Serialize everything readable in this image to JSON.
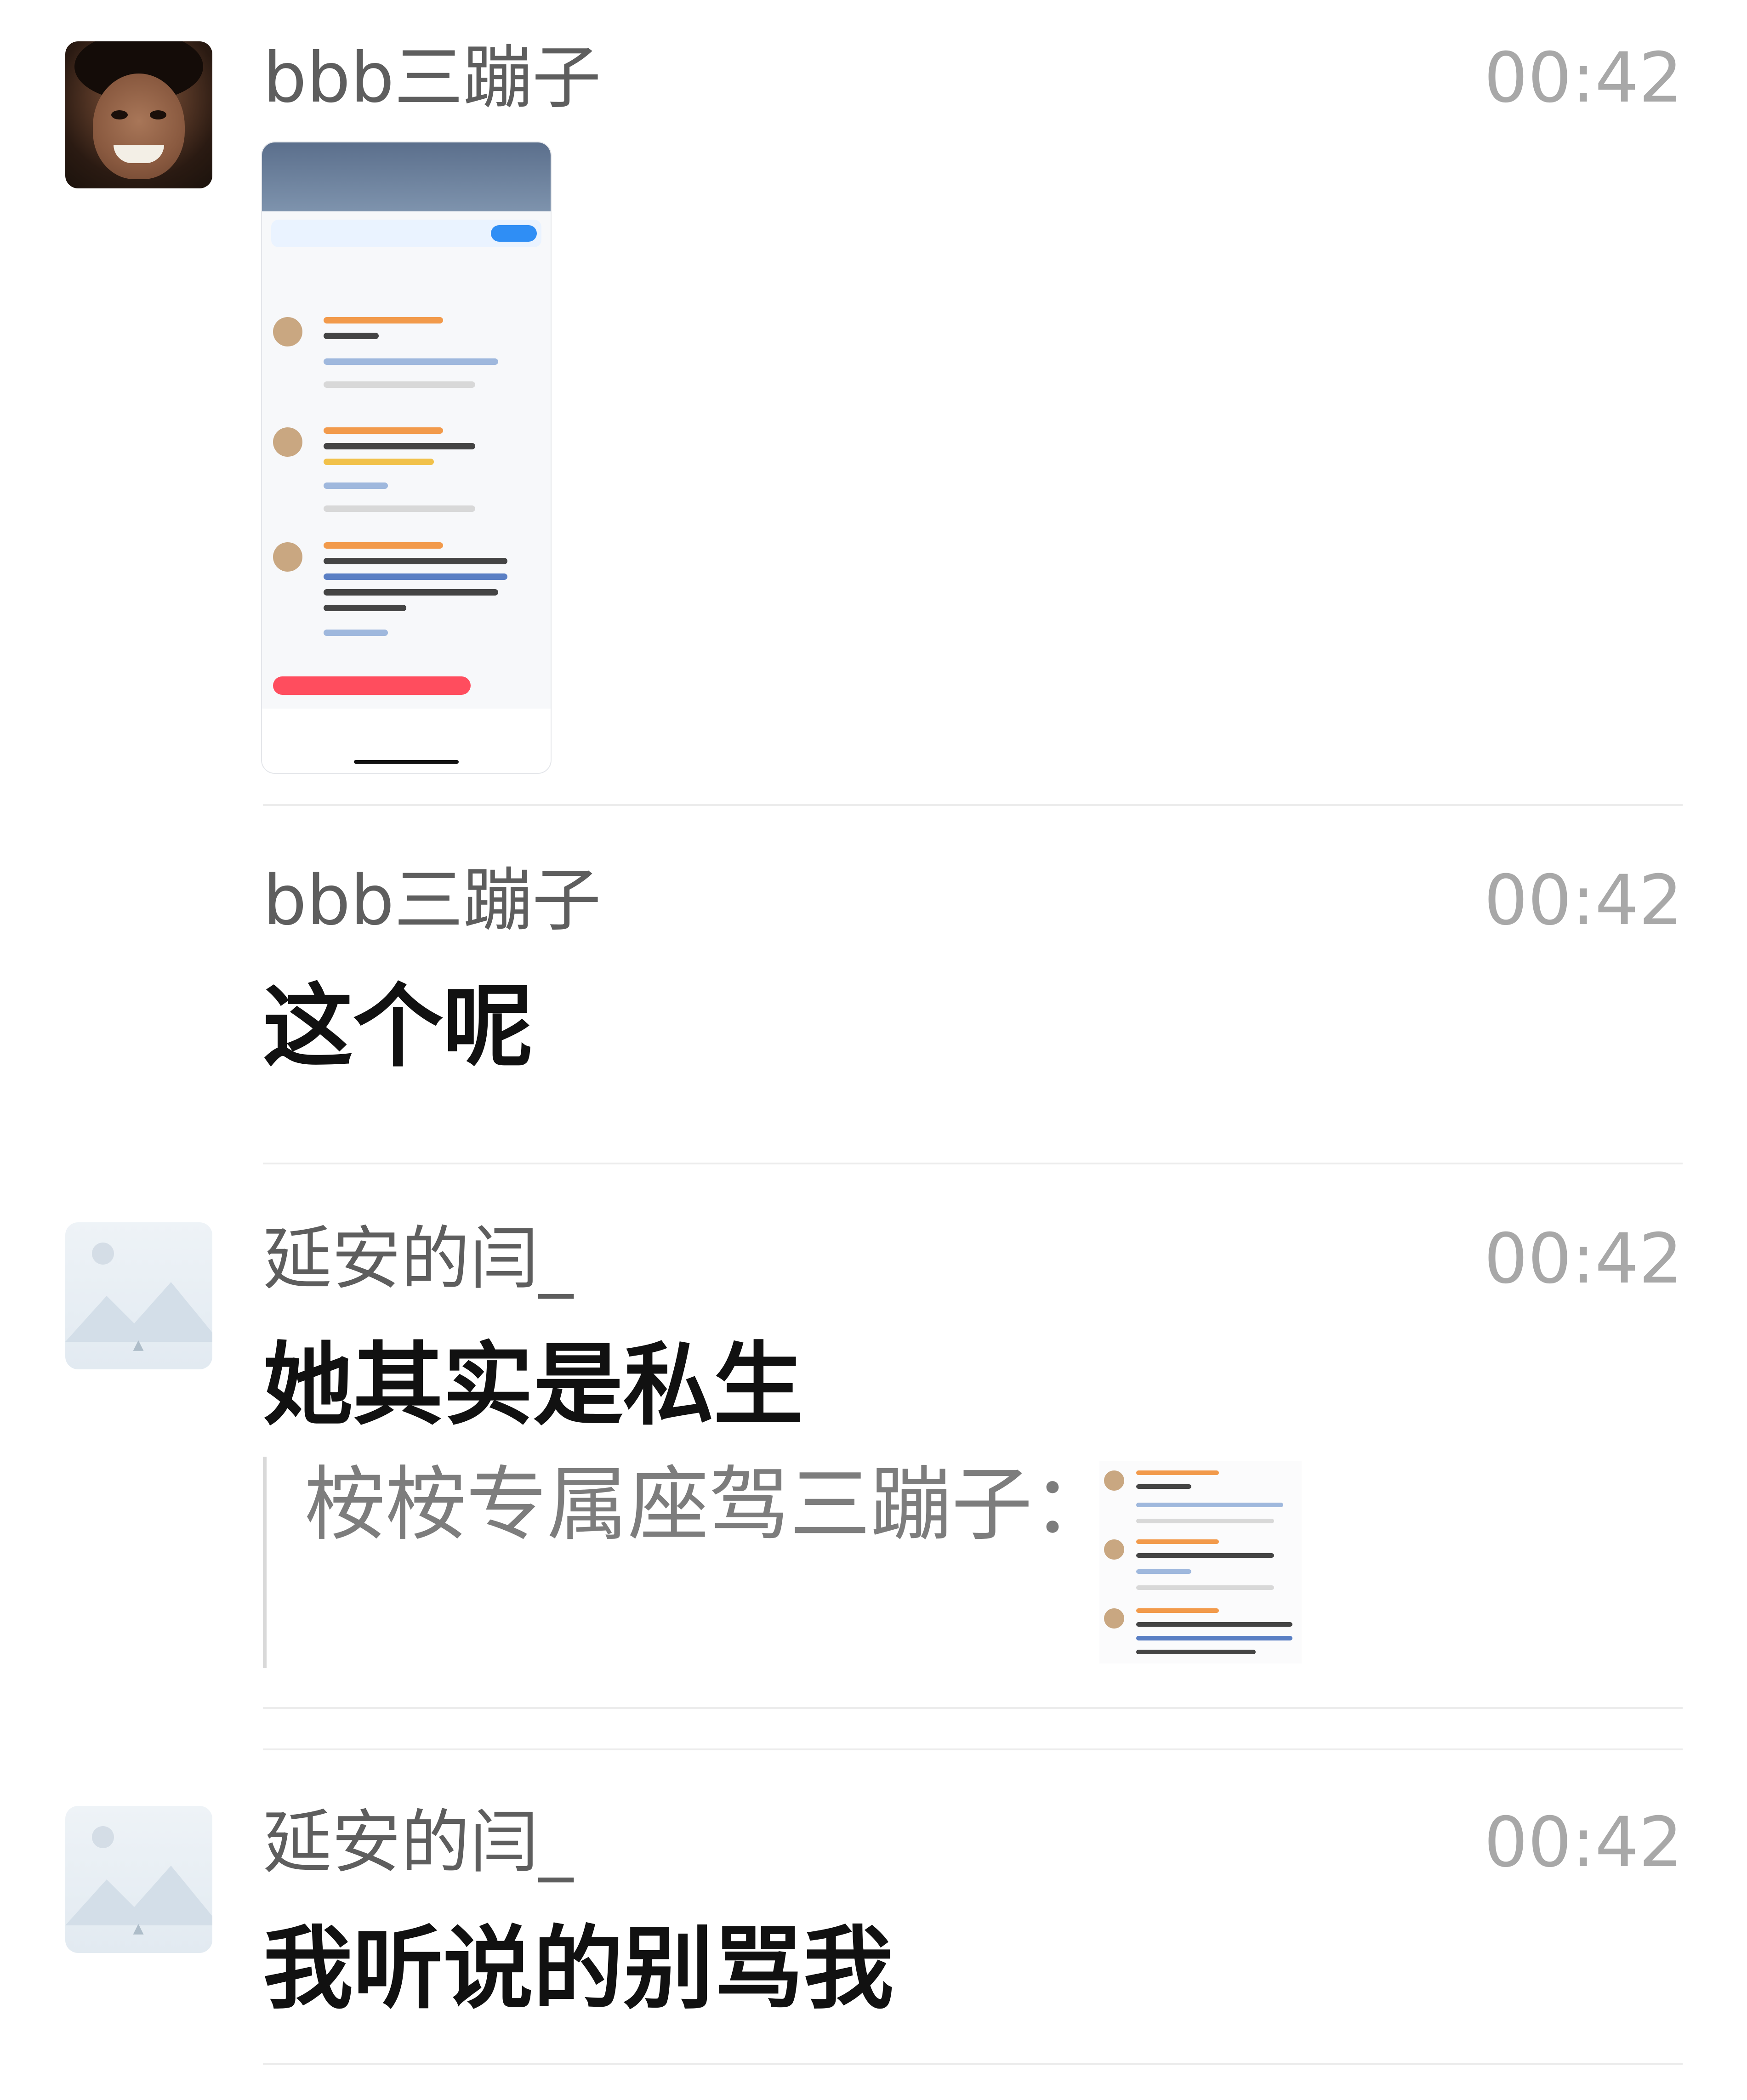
{
  "messages": [
    {
      "sender": "bbb三蹦子",
      "time": "00:42",
      "avatar": "photo",
      "content_type": "image",
      "image_kind": "phone-screenshot"
    },
    {
      "sender": "bbb三蹦子",
      "time": "00:42",
      "content_type": "text",
      "text": "这个呢"
    },
    {
      "sender": "延安的闫_",
      "time": "00:42",
      "avatar": "placeholder",
      "content_type": "text",
      "text": "她其实是私生",
      "quote": {
        "text": "桉桉专属座驾三蹦子："
      }
    },
    {
      "sender": "延安的闫_",
      "time": "00:42",
      "avatar": "placeholder",
      "content_type": "text",
      "text": "我听说的别骂我"
    }
  ],
  "icons": {
    "avatar_placeholder": "mountain-image-icon"
  },
  "colors": {
    "name": "#5e5e5e",
    "time": "#a8a8a8",
    "message_text": "#111111",
    "divider": "#ececec",
    "quote_text": "#7d7d7d"
  }
}
